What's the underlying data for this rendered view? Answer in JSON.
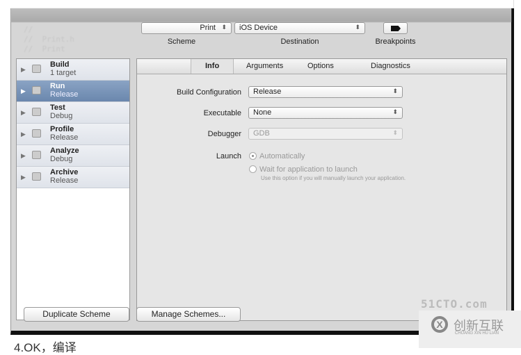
{
  "toolbar": {
    "scheme_value": "Print",
    "scheme_label": "Scheme",
    "destination_value": "iOS Device",
    "destination_label": "Destination",
    "breakpoints_label": "Breakpoints"
  },
  "sidebar": {
    "items": [
      {
        "title": "Build",
        "sub": "1 target"
      },
      {
        "title": "Run",
        "sub": "Release",
        "selected": true
      },
      {
        "title": "Test",
        "sub": "Debug"
      },
      {
        "title": "Profile",
        "sub": "Release"
      },
      {
        "title": "Analyze",
        "sub": "Debug"
      },
      {
        "title": "Archive",
        "sub": "Release"
      }
    ]
  },
  "tabs": [
    "Info",
    "Arguments",
    "Options",
    "Diagnostics"
  ],
  "form": {
    "build_config_label": "Build Configuration",
    "build_config_value": "Release",
    "executable_label": "Executable",
    "executable_value": "None",
    "debugger_label": "Debugger",
    "debugger_value": "GDB",
    "launch_label": "Launch",
    "launch_auto": "Automatically",
    "launch_wait": "Wait for application to launch",
    "launch_hint": "Use this option if you will manually launch your application."
  },
  "buttons": {
    "duplicate": "Duplicate Scheme",
    "manage": "Manage Schemes..."
  },
  "caption": "4.OK，编译",
  "watermark": {
    "site": "51CTO.com",
    "brand": "创新互联",
    "brand_sub": "CHUANG XIN HU LIAN"
  }
}
